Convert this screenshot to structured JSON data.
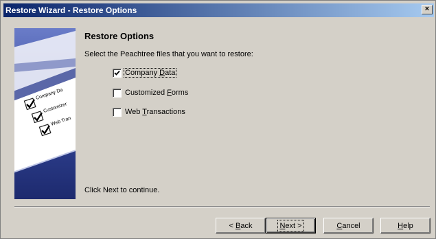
{
  "window": {
    "title": "Restore Wizard - Restore Options",
    "close_glyph": "×"
  },
  "illustration": {
    "items": [
      {
        "label": "Company Da",
        "checked": true
      },
      {
        "label": "Customizer",
        "checked": true
      },
      {
        "label": "Web Tran",
        "checked": true
      }
    ]
  },
  "main": {
    "heading": "Restore Options",
    "description": "Select the Peachtree files that you want to restore:",
    "options": [
      {
        "prefix": "Company ",
        "underline": "D",
        "suffix": "ata",
        "checked": true,
        "focused": true
      },
      {
        "prefix": "Customized ",
        "underline": "F",
        "suffix": "orms",
        "checked": false,
        "focused": false
      },
      {
        "prefix": "Web ",
        "underline": "T",
        "suffix": "ransactions",
        "checked": false,
        "focused": false
      }
    ],
    "footer_note": "Click Next to continue."
  },
  "buttons": {
    "back": {
      "prefix": "< ",
      "underline": "B",
      "suffix": "ack"
    },
    "next": {
      "prefix": "",
      "underline": "N",
      "suffix": "ext >"
    },
    "cancel": {
      "prefix": "",
      "underline": "C",
      "suffix": "ancel"
    },
    "help": {
      "prefix": "",
      "underline": "H",
      "suffix": "elp"
    }
  },
  "colors": {
    "title_start": "#0a246a",
    "title_end": "#a6caf0",
    "panel_dark": "#2a3a8a",
    "face": "#d4d0c8"
  }
}
